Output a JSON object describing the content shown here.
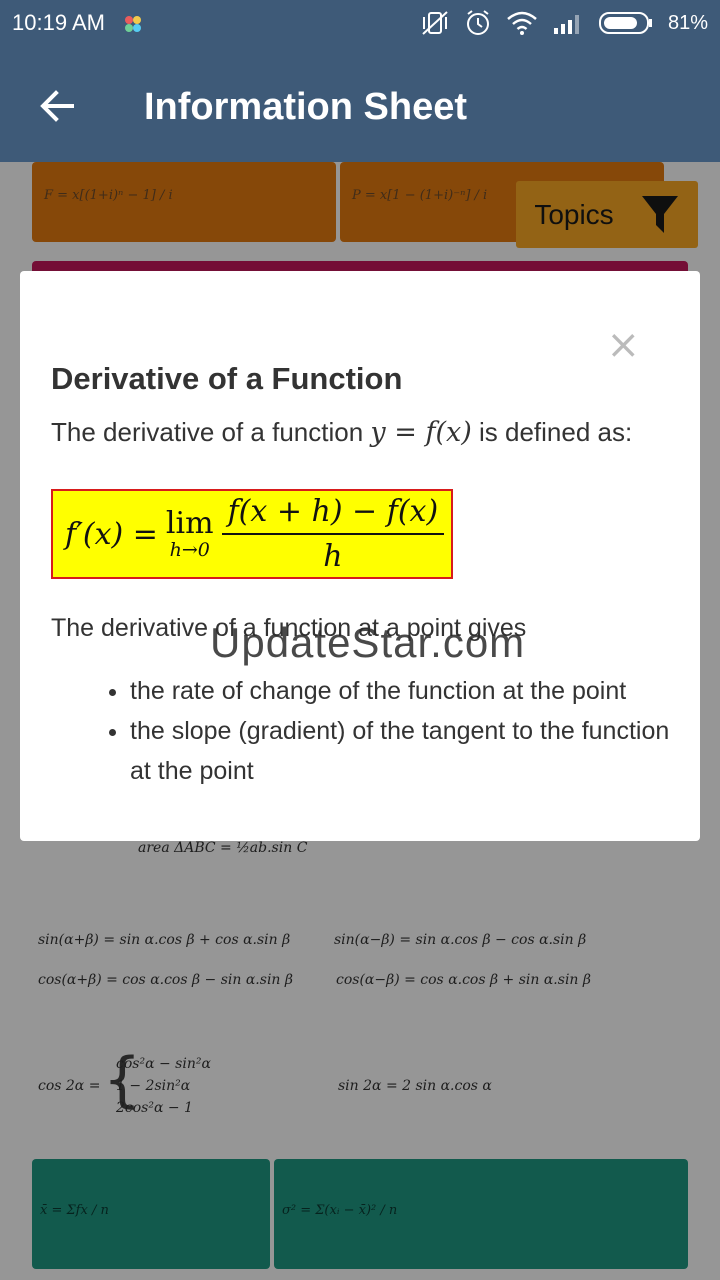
{
  "status_bar": {
    "time": "10:19 AM",
    "battery": "81%"
  },
  "app_bar": {
    "title": "Information Sheet"
  },
  "background": {
    "topics_label": "Topics",
    "formulas": {
      "future_value": "F = x[(1+i)ⁿ − 1] / i",
      "present_value": "P = x[1 − (1+i)⁻ⁿ] / i",
      "area": "area ΔABC = ½ab.sin C",
      "sin_sum": "sin(α+β) = sin α.cos β + cos α.sin β",
      "sin_diff": "sin(α−β) = sin α.cos β − cos α.sin β",
      "cos_sum": "cos(α+β) = cos α.cos β − sin α.sin β",
      "cos_diff": "cos(α−β) = cos α.cos β + sin α.sin β",
      "cos_double_label": "cos 2α =",
      "cos_double_cases": [
        "cos²α − sin²α",
        "1 − 2sin²α",
        "2cos²α − 1"
      ],
      "sin_double": "sin 2α = 2 sin α.cos α",
      "mean": "x̄ = Σfx / n",
      "variance": "σ² = Σ(xᵢ − x̄)² / n"
    }
  },
  "modal": {
    "close": "×",
    "heading": "Derivative of a Function",
    "intro_before": "The derivative of a function",
    "intro_math": "y = f(x)",
    "intro_after": "is defined as:",
    "definition": {
      "lhs": "f′(x) =",
      "lim": "lim",
      "lim_sub": "h→0",
      "numerator": "f(x + h) − f(x)",
      "denominator": "h"
    },
    "paragraph": "The derivative of a function at a point gives",
    "bullets": [
      "the rate of change of the function at the point",
      "the slope (gradient) of the tangent to the function at the point"
    ]
  },
  "watermark": "UpdateStar.com"
}
